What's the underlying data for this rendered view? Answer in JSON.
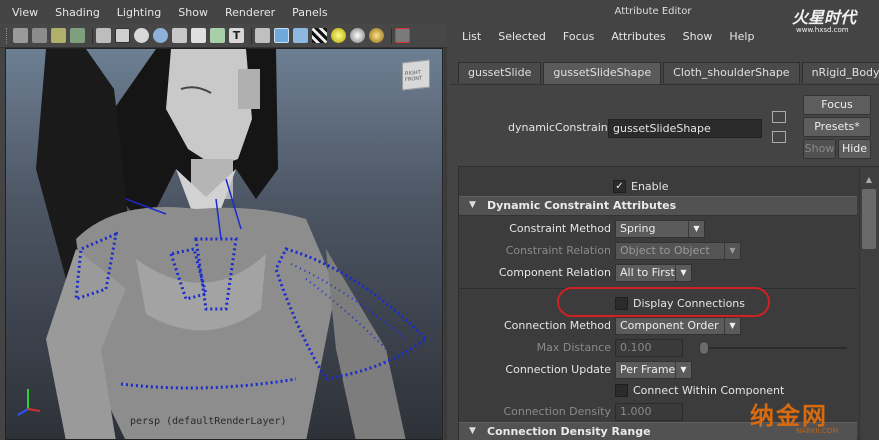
{
  "viewport": {
    "menu": [
      "View",
      "Shading",
      "Lighting",
      "Show",
      "Renderer",
      "Panels"
    ],
    "toolbar_icons": [
      "camera-icon",
      "camera-attributes-icon",
      "bookmark-icon",
      "image-plane-icon",
      "grid-icon",
      "film-gate-icon",
      "resolution-gate-icon",
      "wireframe-icon",
      "smooth-shade-icon",
      "default-material-icon",
      "wireframe-on-shaded-icon",
      "xray-icon",
      "textured-icon",
      "text-icon",
      "isolate-icon",
      "shaded-cube-icon",
      "ortho-cube-icon",
      "checker-icon",
      "light-icon",
      "shadow-icon",
      "select-icon"
    ],
    "view_cube_label": "RIGHT FRONT",
    "camera_label": "persp (defaultRenderLayer)"
  },
  "attribute_editor": {
    "title": "Attribute Editor",
    "menu": [
      "List",
      "Selected",
      "Focus",
      "Attributes",
      "Show",
      "Help"
    ],
    "tabs": [
      "gussetSlide",
      "gussetSlideShape",
      "Cloth_shoulderShape",
      "nRigid_Body"
    ],
    "active_tab_index": 1,
    "node_type_label": "dynamicConstraint:",
    "node_name": "gussetSlideShape",
    "buttons": {
      "focus": "Focus",
      "presets": "Presets*",
      "show": "Show",
      "hide": "Hide"
    },
    "enable": {
      "label": "Enable",
      "checked": true
    },
    "sections": {
      "dynamic": "Dynamic Constraint Attributes",
      "density": "Connection Density Range"
    },
    "fields": {
      "constraint_method": {
        "label": "Constraint Method",
        "value": "Spring"
      },
      "constraint_relation": {
        "label": "Constraint Relation",
        "value": "Object to Object"
      },
      "component_relation": {
        "label": "Component Relation",
        "value": "All to First"
      },
      "display_connections": {
        "label": "Display Connections",
        "checked": false
      },
      "connection_method": {
        "label": "Connection Method",
        "value": "Component Order"
      },
      "max_distance": {
        "label": "Max Distance",
        "value": "0.100"
      },
      "connection_update": {
        "label": "Connection Update",
        "value": "Per Frame"
      },
      "connect_within": {
        "label": "Connect Within Component",
        "checked": false
      },
      "connection_density": {
        "label": "Connection Density",
        "value": "1.000"
      }
    }
  },
  "watermarks": {
    "top": {
      "main": "火星时代",
      "sub": "www.hxsd.com"
    },
    "bottom": {
      "main": "纳金网",
      "sub": "NARKII.COM"
    }
  },
  "colors": {
    "highlight_ellipse": "#d02020",
    "panel_bg": "#444444",
    "viewport_sky": "#6d7f93"
  }
}
